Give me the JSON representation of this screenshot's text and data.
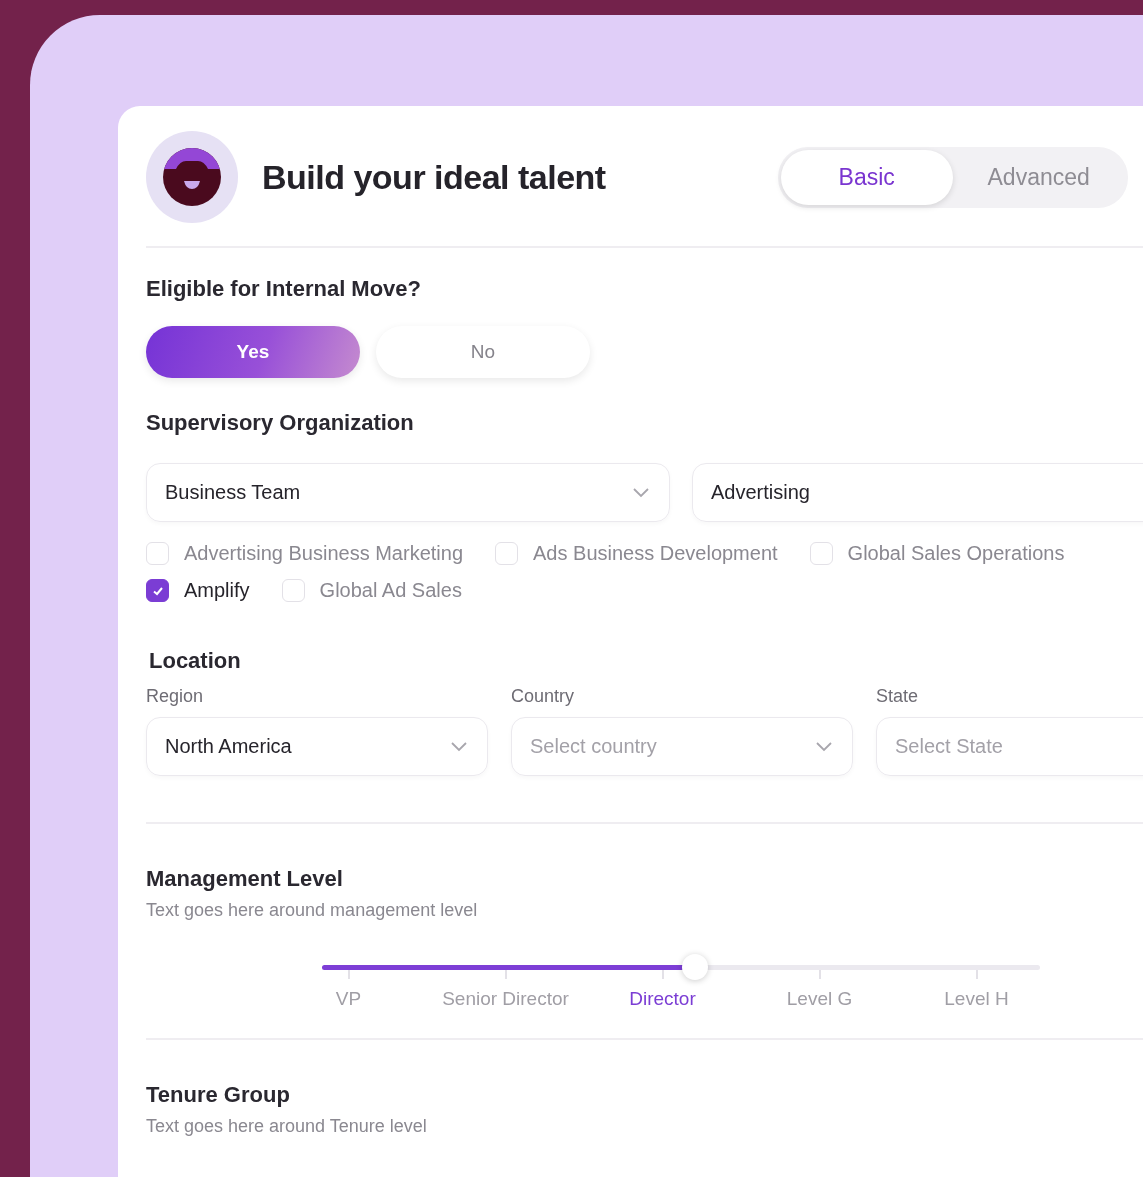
{
  "header": {
    "title": "Build your ideal talent"
  },
  "tabs": [
    {
      "label": "Basic",
      "selected": true
    },
    {
      "label": "Advanced",
      "selected": false
    }
  ],
  "internal_move": {
    "label": "Eligible for Internal Move?",
    "options": [
      {
        "label": "Yes",
        "selected": true
      },
      {
        "label": "No",
        "selected": false
      }
    ]
  },
  "supervisory_organization": {
    "label": "Supervisory Organization",
    "fields": [
      {
        "kind": "select",
        "value": "Business Team"
      },
      {
        "kind": "text",
        "value": "Advertising"
      }
    ],
    "option_rows": [
      [
        {
          "label": "Advertising Business Marketing",
          "checked": false
        },
        {
          "label": "Ads Business Development",
          "checked": false
        },
        {
          "label": "Global Sales Operations",
          "checked": false
        }
      ],
      [
        {
          "label": "Amplify",
          "checked": true
        },
        {
          "label": "Global Ad Sales",
          "checked": false
        }
      ]
    ]
  },
  "location": {
    "label": "Location",
    "fields": [
      {
        "label": "Region",
        "kind": "select",
        "value": "North America"
      },
      {
        "label": "Country",
        "kind": "select",
        "placeholder": "Select country"
      },
      {
        "label": "State",
        "kind": "text",
        "placeholder": "Select State"
      }
    ]
  },
  "management_level": {
    "label": "Management Level",
    "description": "Text goes here around management level",
    "level": 0.52,
    "stops": [
      {
        "label": "VP",
        "selected": false
      },
      {
        "label": "Senior Director",
        "selected": false
      },
      {
        "label": "Director",
        "selected": true
      },
      {
        "label": "Level G",
        "selected": false
      },
      {
        "label": "Level H",
        "selected": false
      }
    ]
  },
  "tenure_group": {
    "label": "Tenure Group",
    "description": "Text goes here around Tenure level"
  }
}
